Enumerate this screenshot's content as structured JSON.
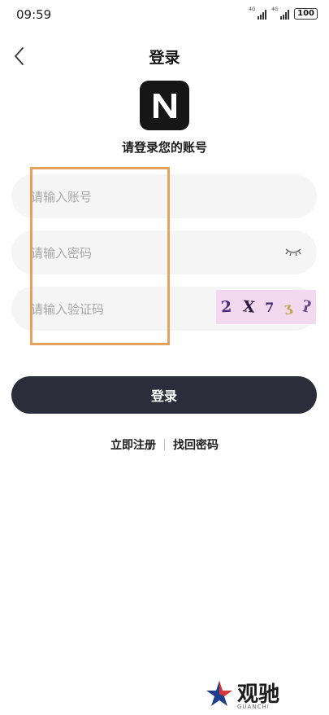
{
  "status_bar": {
    "time": "09:59",
    "signal1": "4G",
    "signal2": "4G",
    "battery": "100"
  },
  "header": {
    "title": "登录",
    "back_icon": "chevron-left-icon"
  },
  "logo": {
    "letter": "N",
    "background": "#161616"
  },
  "subtitle": "请登录您的账号",
  "form": {
    "account_placeholder": "请输入账号",
    "password_placeholder": "请输入密码",
    "captcha_placeholder": "请输入验证码",
    "captcha_chars": [
      "2",
      "X",
      "7",
      "ʒ",
      "ʔ"
    ]
  },
  "login_button": "登录",
  "links": {
    "register": "立即注册",
    "forgot": "找回密码"
  },
  "watermark": {
    "text": "观驰",
    "sub": "GUANCHI"
  },
  "colors": {
    "button": "#2b2e3a",
    "field_bg": "#f5f5f6",
    "annotation": "#e8a15f",
    "captcha_bg": "#f2d9f0"
  }
}
